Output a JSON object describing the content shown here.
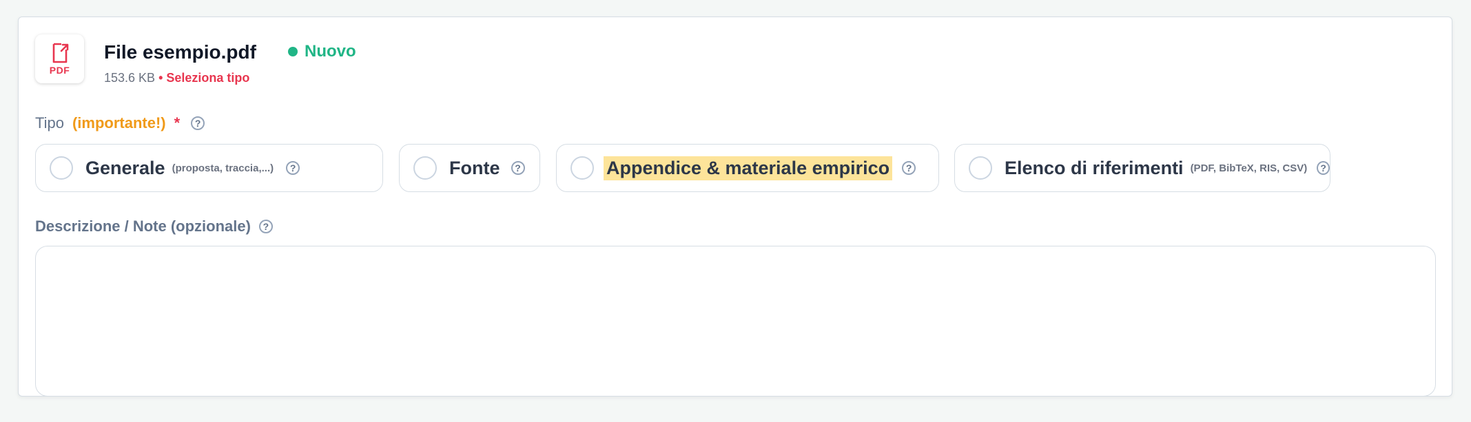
{
  "file": {
    "icon_name": "pdf-file-icon",
    "icon_text": "PDF",
    "name": "File esempio.pdf",
    "status": "Nuovo",
    "status_color": "#20b586",
    "size": "153.6 KB",
    "warning": "• Seleziona tipo",
    "warning_color": "#e8364f"
  },
  "type_field": {
    "label": "Tipo",
    "important": "(importante!)",
    "required_mark": "*",
    "help": "?"
  },
  "type_options": [
    {
      "label": "Generale",
      "sub": "(proposta, traccia,...)",
      "help": "?",
      "selected": false
    },
    {
      "label": "Fonte",
      "sub": "",
      "help": "?",
      "selected": false
    },
    {
      "label": "Appendice & materiale empirico",
      "sub": "",
      "help": "?",
      "selected": false,
      "highlighted": true,
      "highlight_color": "#fde49a"
    },
    {
      "label": "Elenco di riferimenti",
      "sub": "(PDF, BibTeX, RIS, CSV)",
      "help": "?",
      "selected": false
    }
  ],
  "description": {
    "label": "Descrizione / Note (opzionale)",
    "help": "?",
    "value": ""
  }
}
